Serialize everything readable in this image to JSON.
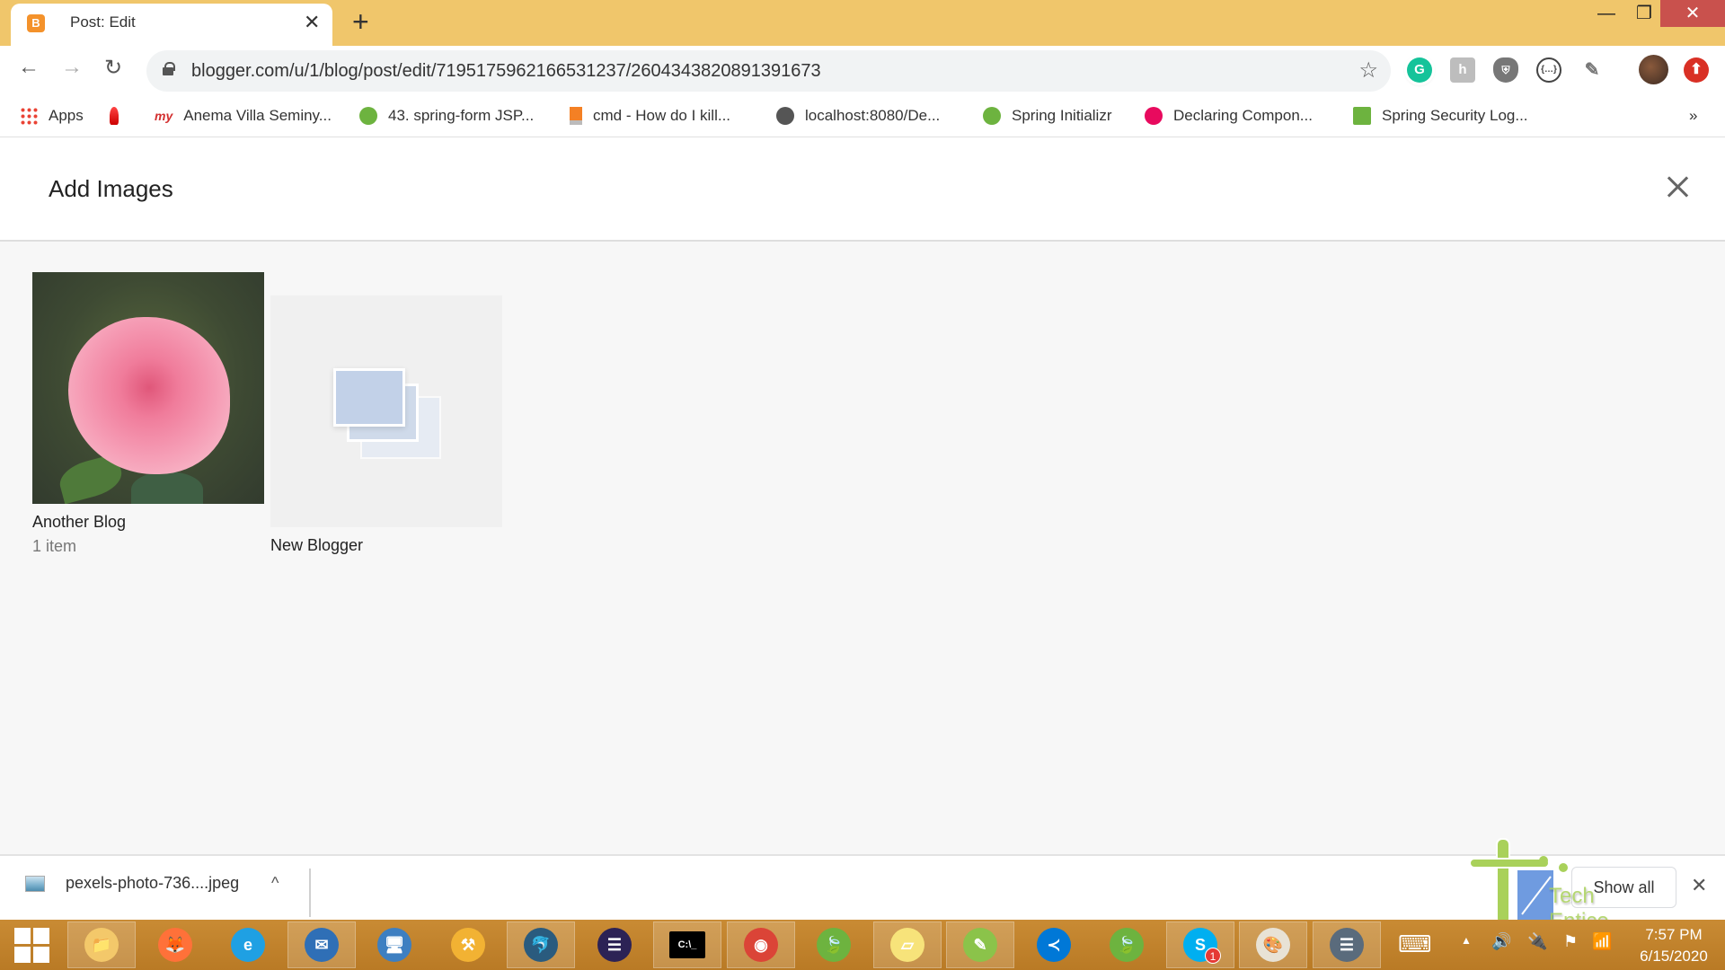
{
  "browser": {
    "tab": {
      "title": "Post: Edit",
      "favicon": "blogger-icon",
      "favicon_letter": "B"
    },
    "new_tab_label": "+",
    "window_controls": {
      "minimize": "—",
      "maximize": "❐",
      "close": "✕"
    },
    "nav": {
      "back": "←",
      "forward": "→",
      "reload": "↻"
    },
    "url": "blogger.com/u/1/blog/post/edit/7195175962166531237/2604343820891391673",
    "star": "☆",
    "extensions": [
      {
        "name": "grammarly-icon",
        "glyph": "G",
        "color": "#15c39a"
      },
      {
        "name": "honey-icon",
        "glyph": "h",
        "color": "#bdbdbd"
      },
      {
        "name": "adblock-shield-icon",
        "glyph": "⛨",
        "color": "#777777"
      },
      {
        "name": "json-formatter-icon",
        "glyph": "{…}",
        "color": "#ffffff"
      },
      {
        "name": "eyedropper-icon",
        "glyph": "✎",
        "color": "#ffffff"
      }
    ],
    "profile_avatar": "avatar",
    "update_badge": "⬆",
    "bookmarks": [
      {
        "label": "Apps",
        "icon": "apps-grid-icon"
      },
      {
        "label": "",
        "icon": "flame-icon"
      },
      {
        "label": "Anema Villa Seminy...",
        "icon": "my-logo-icon"
      },
      {
        "label": "43. spring-form JSP...",
        "icon": "spring-icon"
      },
      {
        "label": "cmd - How do I kill...",
        "icon": "stackoverflow-icon"
      },
      {
        "label": "localhost:8080/De...",
        "icon": "globe-icon"
      },
      {
        "label": "Spring Initializr",
        "icon": "spring-icon"
      },
      {
        "label": "Declaring Compon...",
        "icon": "pluralsight-icon"
      },
      {
        "label": "Spring Security Log...",
        "icon": "spring-leaf-icon"
      }
    ],
    "bookmarks_overflow": "»"
  },
  "dialog": {
    "title": "Add Images",
    "albums": [
      {
        "name": "Another Blog",
        "count": "1 item",
        "thumbnail": "pink-rose-photo"
      },
      {
        "name": "New Blogger",
        "count": "",
        "thumbnail": "empty-album-placeholder"
      }
    ]
  },
  "download_bar": {
    "file_name": "pexels-photo-736....jpeg",
    "chevron": "^",
    "show_all": "Show all",
    "close": "✕",
    "watermark": "Tech Entice"
  },
  "taskbar": {
    "apps": [
      {
        "name": "file-explorer",
        "glyph": "📁",
        "color": "#f3c86a",
        "active": true
      },
      {
        "name": "firefox",
        "glyph": "🦊",
        "color": "#ff7139",
        "active": false
      },
      {
        "name": "internet-explorer",
        "glyph": "e",
        "color": "#1fa0e3",
        "active": false
      },
      {
        "name": "thunderbird",
        "glyph": "✉",
        "color": "#2f6fb6",
        "active": true
      },
      {
        "name": "remote-desktop",
        "glyph": "🖥",
        "color": "#3d7fc1",
        "active": false
      },
      {
        "name": "db-tools",
        "glyph": "⚒",
        "color": "#f2b233",
        "active": false
      },
      {
        "name": "mysql-workbench",
        "glyph": "🐬",
        "color": "#2a5b7e",
        "active": true
      },
      {
        "name": "eclipse",
        "glyph": "☰",
        "color": "#2c2255",
        "active": false
      },
      {
        "name": "command-prompt",
        "glyph": "C:\\_",
        "color": "#000000",
        "active": true
      },
      {
        "name": "chrome",
        "glyph": "◉",
        "color": "#db4437",
        "active": true
      },
      {
        "name": "spring-tool-suite",
        "glyph": "🍃",
        "color": "#6db33f",
        "active": false
      },
      {
        "name": "sticky-notes",
        "glyph": "▱",
        "color": "#f7e37a",
        "active": true
      },
      {
        "name": "notepad-plus-plus",
        "glyph": "✎",
        "color": "#8bc34a",
        "active": true
      },
      {
        "name": "vscode",
        "glyph": "≺",
        "color": "#0078d7",
        "active": false
      },
      {
        "name": "spring-tool-suite-2",
        "glyph": "🍃",
        "color": "#6db33f",
        "active": false
      },
      {
        "name": "skype",
        "glyph": "S",
        "color": "#00aff0",
        "active": true,
        "badge": "1"
      },
      {
        "name": "paint",
        "glyph": "🎨",
        "color": "#e8e2d5",
        "active": true
      },
      {
        "name": "document-viewer",
        "glyph": "☰",
        "color": "#5a6b7c",
        "active": true
      }
    ],
    "tray": {
      "keyboard": "⌨",
      "show_hidden": "▲",
      "volume": "🔊",
      "power": "🔌",
      "action_center": "⚑",
      "network": "📶"
    },
    "clock": {
      "time": "7:57 PM",
      "date": "6/15/2020"
    }
  }
}
